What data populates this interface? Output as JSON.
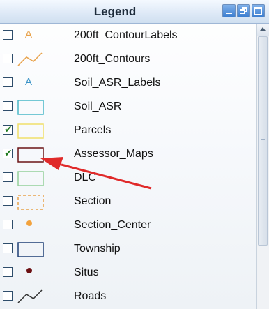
{
  "window": {
    "title": "Legend",
    "buttons": [
      "minimize",
      "restore",
      "maximize"
    ]
  },
  "layers": [
    {
      "label": "200ft_ContourLabels",
      "checked": false,
      "symbol": "text-A",
      "color": "#e8a24a"
    },
    {
      "label": "200ft_Contours",
      "checked": false,
      "symbol": "line",
      "color": "#e8a24a"
    },
    {
      "label": "Soil_ASR_Labels",
      "checked": false,
      "symbol": "text-A",
      "color": "#3a93c7"
    },
    {
      "label": "Soil_ASR",
      "checked": false,
      "symbol": "rect",
      "color": "#49b8c8"
    },
    {
      "label": "Parcels",
      "checked": true,
      "symbol": "rect",
      "color": "#f0df6a"
    },
    {
      "label": "Assessor_Maps",
      "checked": true,
      "symbol": "rect",
      "color": "#6b1416"
    },
    {
      "label": "DLC",
      "checked": false,
      "symbol": "rect",
      "color": "#93d09a"
    },
    {
      "label": "Section",
      "checked": false,
      "symbol": "rect-dashed",
      "color": "#e8a24a"
    },
    {
      "label": "Section_Center",
      "checked": false,
      "symbol": "dot",
      "color": "#f2a23d"
    },
    {
      "label": "Township",
      "checked": false,
      "symbol": "rect",
      "color": "#1f3f76"
    },
    {
      "label": "Situs",
      "checked": false,
      "symbol": "dot",
      "color": "#6b0f12"
    },
    {
      "label": "Roads",
      "checked": false,
      "symbol": "line",
      "color": "#333333"
    }
  ],
  "annotation": {
    "arrow_color": "#e02a2a"
  }
}
